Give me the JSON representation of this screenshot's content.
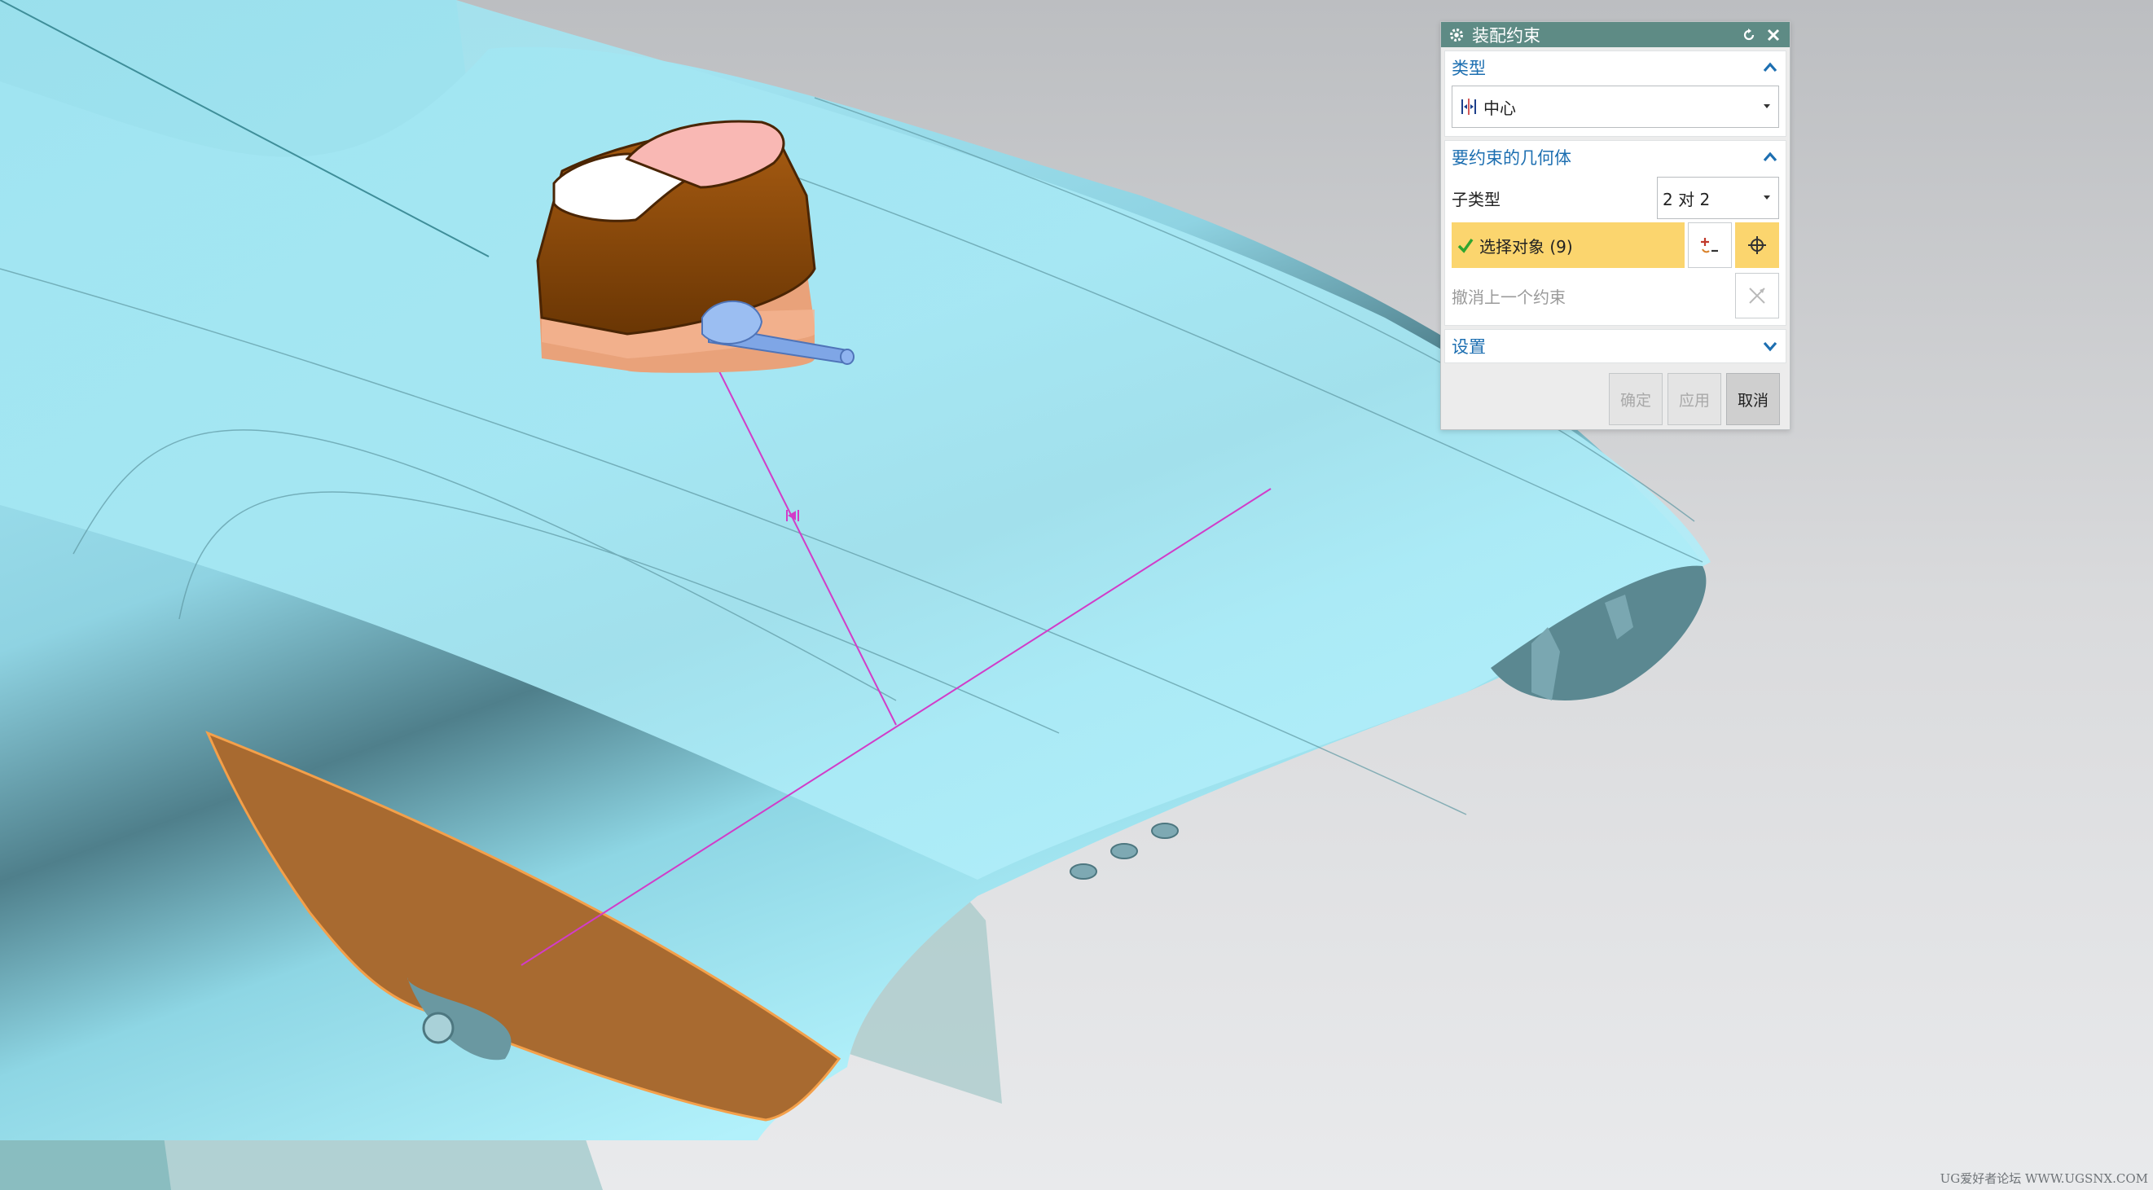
{
  "dialog": {
    "title": "装配约束",
    "type_section": {
      "header": "类型",
      "selected_type": "中心"
    },
    "geometry_section": {
      "header": "要约束的几何体",
      "subtype_label": "子类型",
      "subtype_value": "2 对 2",
      "select_objects_label": "选择对象 (9)",
      "undo_label": "撤消上一个约束"
    },
    "settings_section": {
      "header": "设置"
    },
    "buttons": {
      "ok": "确定",
      "apply": "应用",
      "cancel": "取消"
    }
  },
  "watermark": "UG爱好者论坛 WWW.UGSNX.COM",
  "colors": {
    "titlebar": "#5e8b85",
    "section_header": "#1d6fb1",
    "selection_highlight": "#fbd56e",
    "model_body": "#a9ecf8",
    "constraint_line": "#d23cc8",
    "orange_face": "#a86a30"
  }
}
